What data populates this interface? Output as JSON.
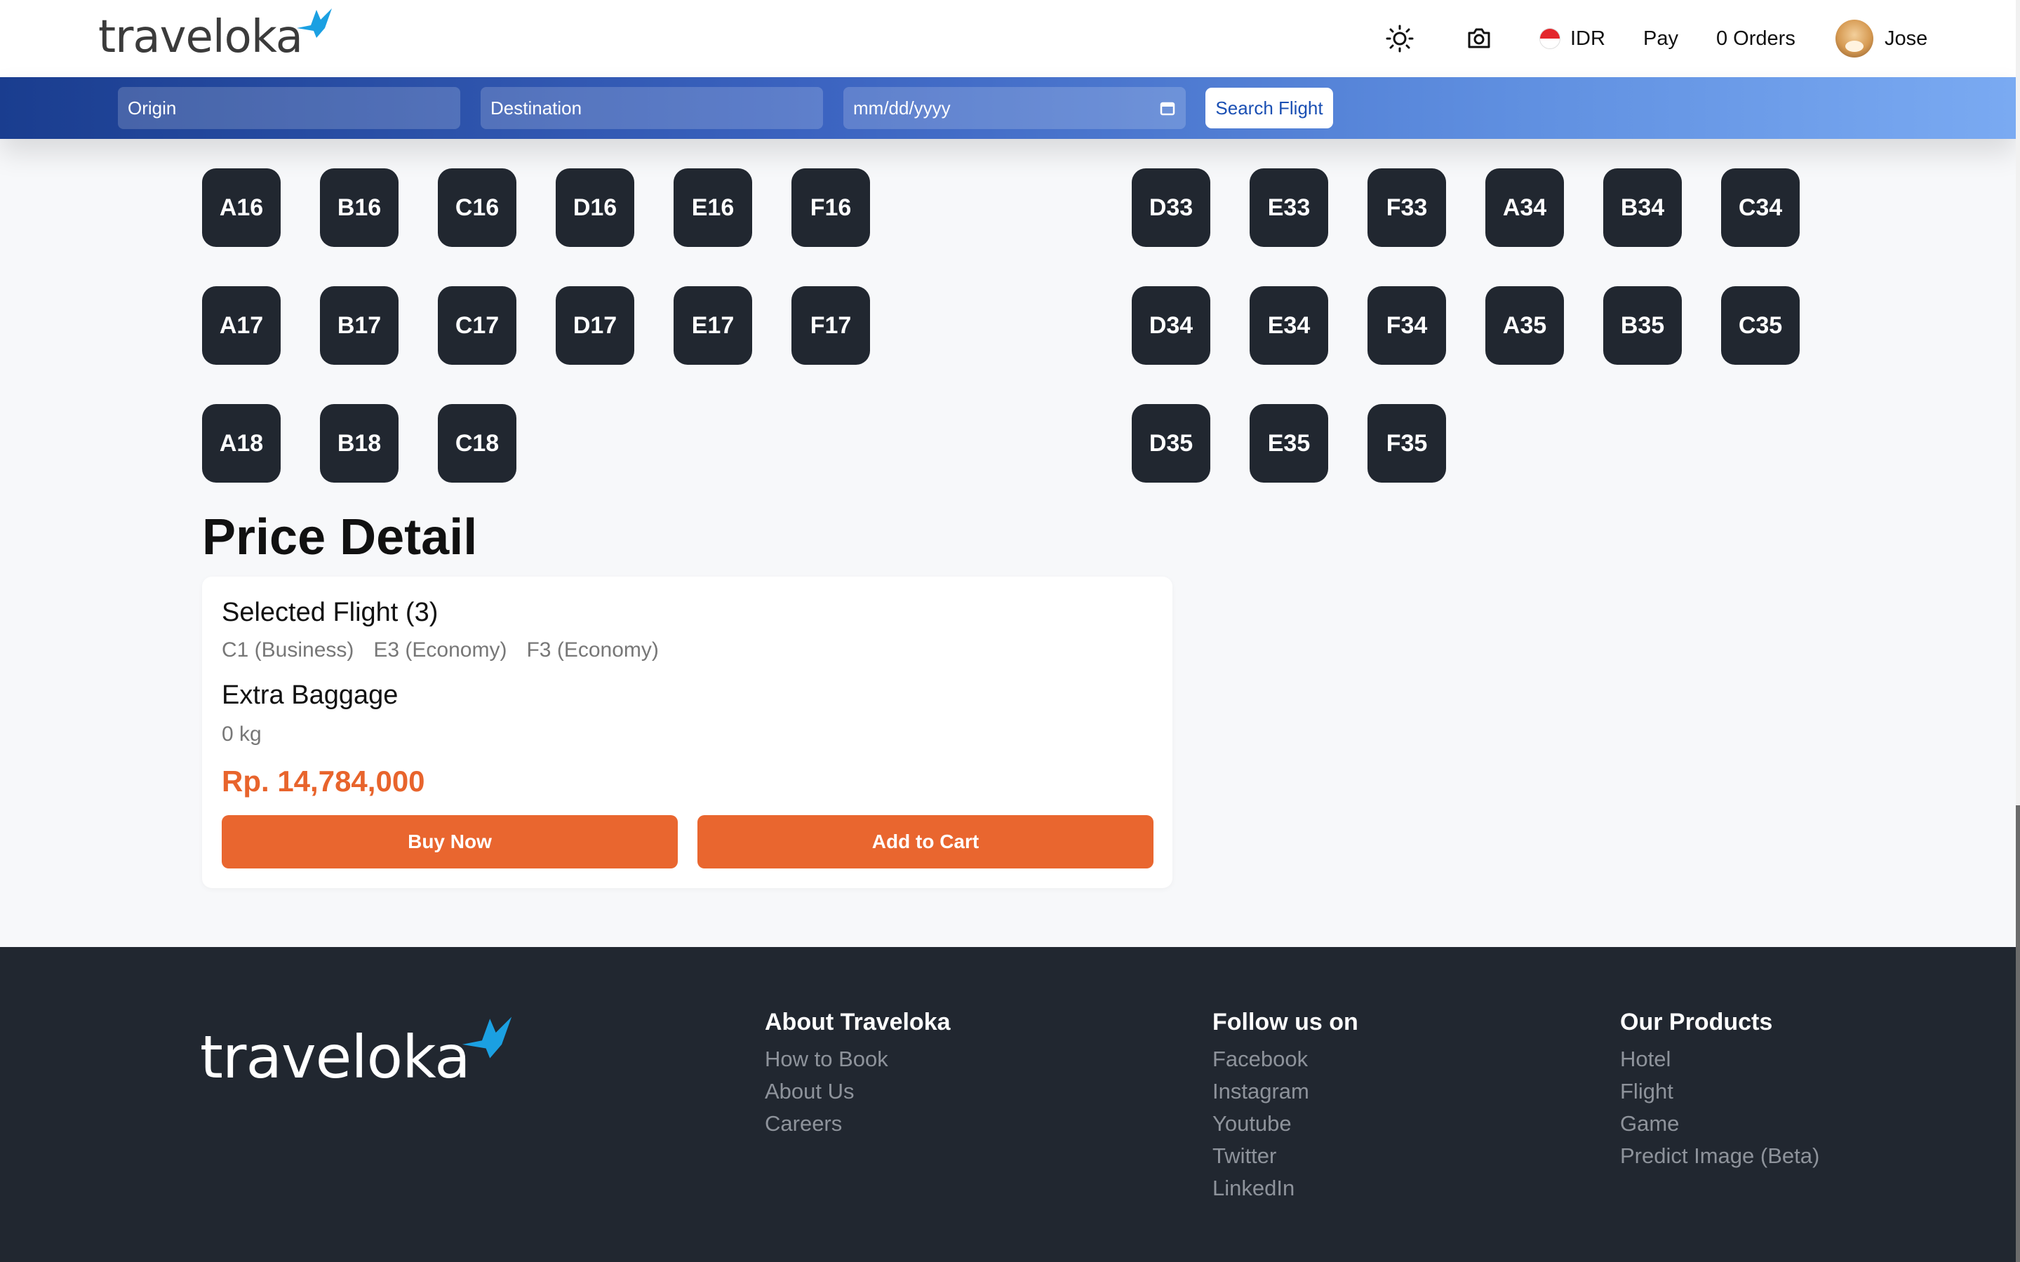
{
  "header": {
    "logo": "traveloka",
    "currency": "IDR",
    "pay": "Pay",
    "orders": "0 Orders",
    "user": "Jose",
    "icons": [
      "sun-icon",
      "camera-icon",
      "indonesia-flag-icon"
    ]
  },
  "search": {
    "origin_placeholder": "Origin",
    "destination_placeholder": "Destination",
    "date_placeholder": "mm/dd/yyyy",
    "button": "Search Flight"
  },
  "seats": {
    "left": [
      [
        "A16",
        "B16",
        "C16",
        "D16",
        "E16",
        "F16"
      ],
      [
        "A17",
        "B17",
        "C17",
        "D17",
        "E17",
        "F17"
      ],
      [
        "A18",
        "B18",
        "C18"
      ]
    ],
    "right": [
      [
        "D33",
        "E33",
        "F33",
        "A34",
        "B34",
        "C34"
      ],
      [
        "D34",
        "E34",
        "F34",
        "A35",
        "B35",
        "C35"
      ],
      [
        "D35",
        "E35",
        "F35"
      ]
    ]
  },
  "price_detail": {
    "title": "Price Detail",
    "selected_label": "Selected Flight (3)",
    "selected_seats": [
      "C1 (Business)",
      "E3 (Economy)",
      "F3 (Economy)"
    ],
    "baggage_label": "Extra Baggage",
    "baggage_value": "0 kg",
    "total": "Rp. 14,784,000",
    "buy_now": "Buy Now",
    "add_to_cart": "Add to Cart"
  },
  "footer": {
    "logo": "traveloka",
    "columns": [
      {
        "title": "About Traveloka",
        "links": [
          "How to Book",
          "About Us",
          "Careers"
        ]
      },
      {
        "title": "Follow us on",
        "links": [
          "Facebook",
          "Instagram",
          "Youtube",
          "Twitter",
          "LinkedIn"
        ]
      },
      {
        "title": "Our Products",
        "links": [
          "Hotel",
          "Flight",
          "Game",
          "Predict Image (Beta)"
        ]
      }
    ]
  },
  "colors": {
    "brand_dark": "#212730",
    "accent_orange": "#e9662f",
    "search_bar_start": "#1a3d8f",
    "search_bar_end": "#7aaaf2",
    "logo_bird": "#1ba0e2"
  }
}
